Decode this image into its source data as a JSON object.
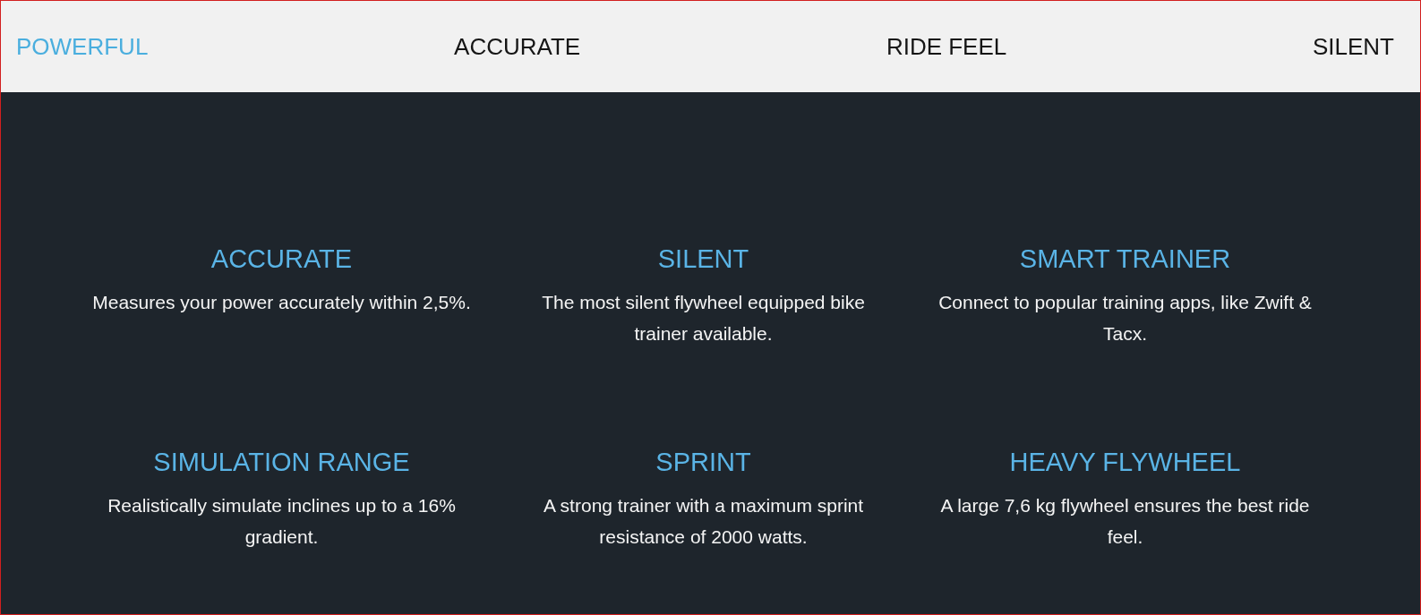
{
  "tabs": [
    {
      "label": "POWERFUL",
      "selected": true
    },
    {
      "label": "ACCURATE",
      "selected": false
    },
    {
      "label": "RIDE FEEL",
      "selected": false
    },
    {
      "label": "SILENT",
      "selected": false
    }
  ],
  "features": [
    {
      "title": "ACCURATE",
      "description": "Measures your power accurately within 2,5%."
    },
    {
      "title": "SILENT",
      "description": "The most silent flywheel equipped bike trainer available."
    },
    {
      "title": "SMART TRAINER",
      "description": "Connect to popular training apps, like Zwift & Tacx."
    },
    {
      "title": "SIMULATION RANGE",
      "description": "Realistically simulate inclines up to a 16% gradient."
    },
    {
      "title": "SPRINT",
      "description": "A strong trainer with a maximum sprint resistance of 2000 watts."
    },
    {
      "title": "HEAVY FLYWHEEL",
      "description": "A large 7,6 kg flywheel ensures the best ride feel."
    }
  ]
}
